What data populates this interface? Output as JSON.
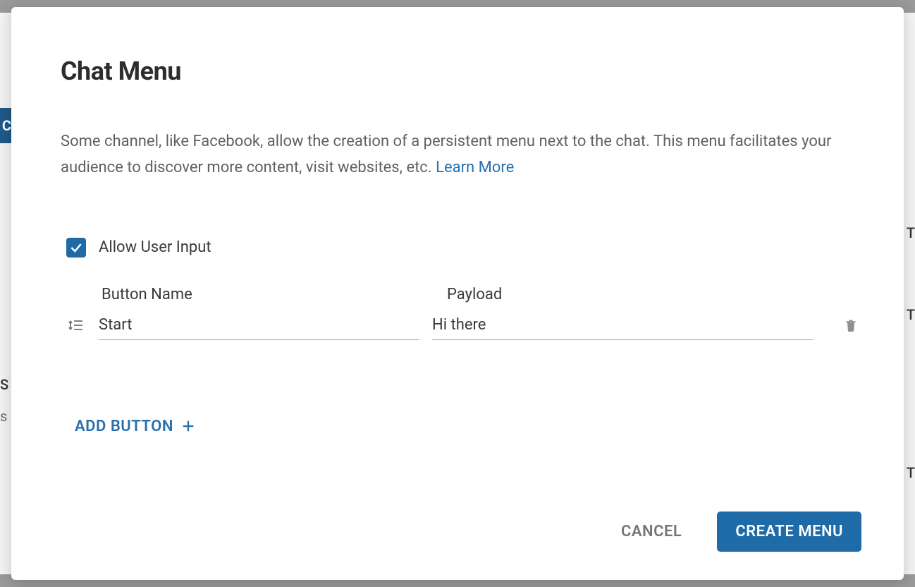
{
  "modal": {
    "title": "Chat Menu",
    "description_text": "Some channel, like Facebook, allow the creation of a persistent menu next to the chat. This menu facilitates your audience to discover more content, visit websites, etc. ",
    "learn_more_label": "Learn More",
    "allow_user_input_label": "Allow User Input",
    "allow_user_input_checked": true,
    "columns": {
      "name": "Button Name",
      "payload": "Payload"
    },
    "rows": [
      {
        "name": "Start",
        "payload": "Hi there"
      }
    ],
    "add_button_label": "ADD BUTTON",
    "actions": {
      "cancel": "CANCEL",
      "create": "CREATE MENU"
    }
  },
  "background": {
    "tab_letter": "C",
    "letter_t": "T",
    "letter_s_upper": "S",
    "letter_s_lower": "s"
  }
}
